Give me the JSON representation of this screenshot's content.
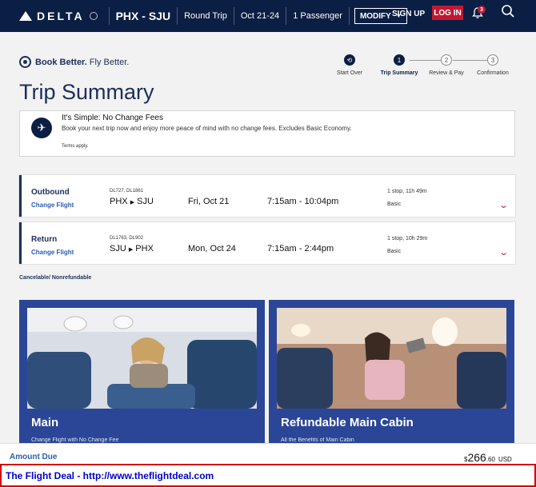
{
  "header": {
    "logo": "DELTA",
    "route": "PHX - SJU",
    "trip_type": "Round Trip",
    "dates": "Oct 21-24",
    "passengers": "1 Passenger",
    "modify_label": "MODIFY",
    "signup_label": "SIGN UP",
    "login_label": "LOG IN",
    "notification_count": "3"
  },
  "tagline": {
    "book": "Book Better.",
    "fly": "Fly Better."
  },
  "stepper": {
    "steps": [
      {
        "label": "Start Over",
        "num": ""
      },
      {
        "label": "Trip Summary",
        "num": "1"
      },
      {
        "label": "Review & Pay",
        "num": "2"
      },
      {
        "label": "Confirmation",
        "num": "3"
      }
    ]
  },
  "page_title": "Trip Summary",
  "no_change": {
    "title": "It's Simple: No Change Fees",
    "body": "Book your next trip now and enjoy more peace of mind with no change fees. Excludes Basic Economy.",
    "terms": "Terms apply."
  },
  "flights": [
    {
      "type": "Outbound",
      "change": "Change Flight",
      "numbers": "DL727, DL1861",
      "from": "PHX",
      "to": "SJU",
      "date": "Fri, Oct 21",
      "time": "7:15am - 10:04pm",
      "stops": "1 stop, 11h 49m",
      "class": "Basic"
    },
    {
      "type": "Return",
      "change": "Change Flight",
      "numbers": "DL1763, DL902",
      "from": "SJU",
      "to": "PHX",
      "date": "Mon, Oct 24",
      "time": "7:15am - 2:44pm",
      "stops": "1 stop, 10h 29m",
      "class": "Basic"
    }
  ],
  "cancel_note": "Cancelable/ Nonrefundable",
  "fares": [
    {
      "name": "Main",
      "sub": "Change Flight with No Change Fee"
    },
    {
      "name": "Refundable Main Cabin",
      "sub": "All the Benefits of Main Cabin"
    }
  ],
  "amount": {
    "label": "Amount Due",
    "currency": "$",
    "dollars": "266",
    "cents": ".60",
    "code": "USD"
  },
  "banner": "The Flight Deal - http://www.theflightdeal.com"
}
